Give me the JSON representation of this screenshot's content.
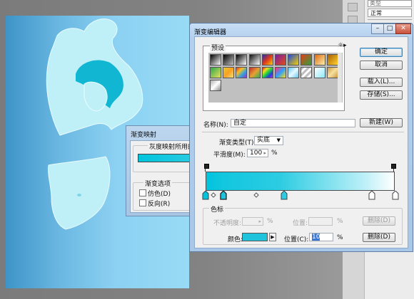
{
  "right_panel": {
    "field_text": "类型",
    "blend_mode": "正常"
  },
  "gradient_map": {
    "title": "渐变映射",
    "used_label": "灰度映射所用的",
    "options_group": "渐变选项",
    "dither": "仿色(D)",
    "reverse": "反向(R)"
  },
  "gradient_editor": {
    "title": "渐变编辑器",
    "presets_label": "预设",
    "buttons": {
      "ok": "确定",
      "cancel": "取消",
      "load": "载入(L)...",
      "save": "存储(S)...",
      "new": "新建(W)",
      "delete_opacity": "删除(D)",
      "delete_color": "删除(D)"
    },
    "name_label": "名称(N):",
    "name_value": "自定",
    "type_label": "渐变类型(T):",
    "type_value": "实底",
    "smoothness_label": "平滑度(M):",
    "smoothness_value": "100",
    "percent": "%",
    "stops_group": "色标",
    "opacity_label": "不透明度:",
    "location_label_disabled": "位置:",
    "color_label": "颜色:",
    "location_label": "位置(C):",
    "location_value": "10",
    "selected_color": "#1fc4dc"
  },
  "presets": [
    "linear-gradient(135deg,#000,#fff)",
    "linear-gradient(135deg,#000,rgba(0,0,0,0))",
    "linear-gradient(135deg,#000,#fff)",
    "linear-gradient(135deg,#111,#fff)",
    "linear-gradient(135deg,#2a2aa8,#e03a1a,#f5d10a)",
    "linear-gradient(135deg,#7a1fa3,#e84a14)",
    "linear-gradient(135deg,#2048d8,#f5d000)",
    "linear-gradient(135deg,#e0401a,#2ea03a)",
    "linear-gradient(135deg,#e06a10,#f8f0b0)",
    "linear-gradient(135deg,#a86000,#ffd030)",
    "linear-gradient(135deg,#2ea848,#e8e060)",
    "linear-gradient(135deg,#e8c830,#f8a020,#f0e080)",
    "linear-gradient(135deg,#e03030,#f8c020,#30a0e0,#a030d0)",
    "linear-gradient(135deg,#c03030,#e8a030,#30b050)",
    "linear-gradient(135deg,#e02020,#f0e020,#20d040,#2040e0,#d020e0)",
    "linear-gradient(135deg,#ff3070,#30a0ff,#ffe000)",
    "linear-gradient(135deg,#60c8f0,#e8f8ff,#60c8f0)",
    "repeating-linear-gradient(135deg,#c0c0c0 0 3px,#fff 3px 6px)",
    "linear-gradient(135deg,#ffffff,#90e8f8)",
    "linear-gradient(135deg,#c89840,#f8e0a0,#c89840)",
    "linear-gradient(135deg,#b0b0b0,#ffffff,#888)"
  ]
}
